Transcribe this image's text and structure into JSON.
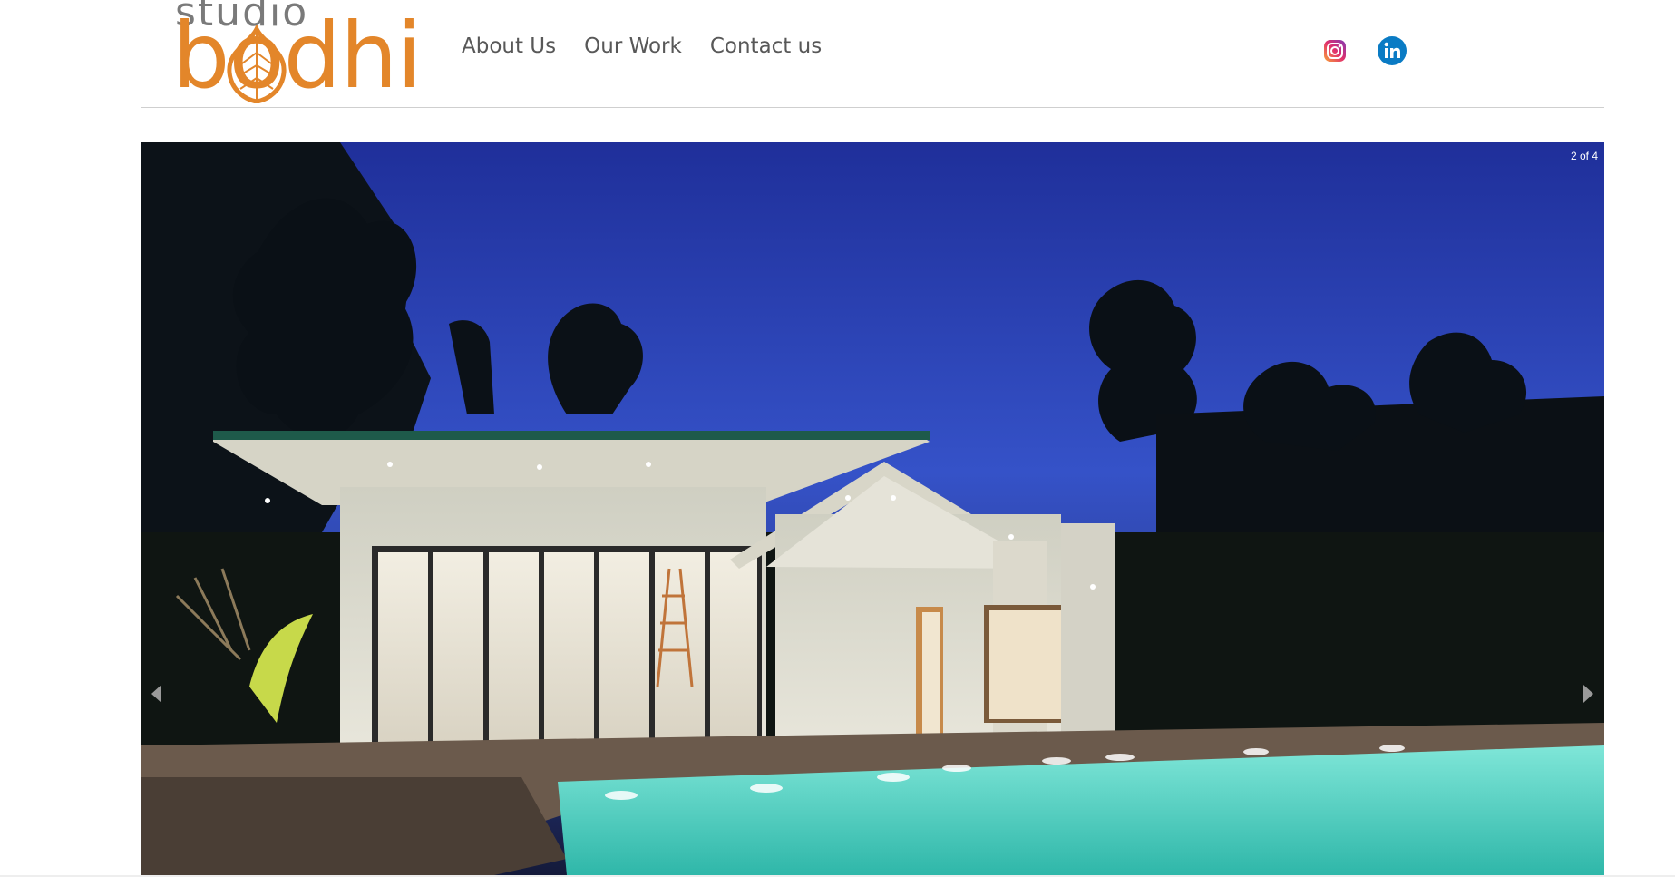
{
  "logo": {
    "top_text": "studio",
    "main_text": "bodhi"
  },
  "nav": {
    "items": [
      {
        "label": "About Us"
      },
      {
        "label": "Our Work"
      },
      {
        "label": "Contact us"
      }
    ]
  },
  "social": {
    "icons": [
      "instagram-icon",
      "linkedin-icon"
    ]
  },
  "slider": {
    "counter": "2 of 4",
    "image": "night-pool-house"
  },
  "colors": {
    "brand_orange": "#e3862a",
    "nav_text": "#585858",
    "linkedin_blue": "#0a7bc4",
    "pool": "#4fd2c4",
    "sky": "#1f2f9a"
  }
}
